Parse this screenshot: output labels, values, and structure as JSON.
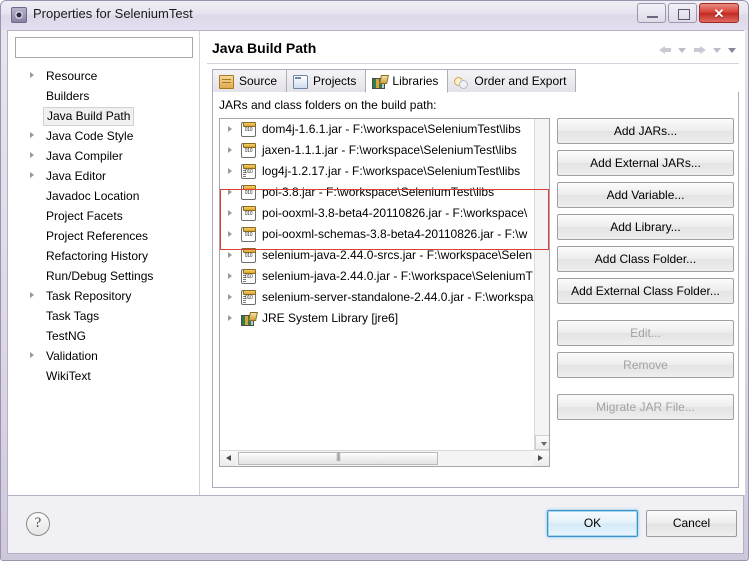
{
  "window": {
    "title": "Properties for SeleniumTest",
    "icon": "properties-icon",
    "minimize_label": "",
    "maximize_label": "",
    "close_label": "✕"
  },
  "sidebar": {
    "filter_value": "",
    "filter_placeholder": "",
    "items": [
      {
        "label": "Resource",
        "expandable": true,
        "selected": false
      },
      {
        "label": "Builders",
        "expandable": false,
        "selected": false
      },
      {
        "label": "Java Build Path",
        "expandable": false,
        "selected": true
      },
      {
        "label": "Java Code Style",
        "expandable": true,
        "selected": false
      },
      {
        "label": "Java Compiler",
        "expandable": true,
        "selected": false
      },
      {
        "label": "Java Editor",
        "expandable": true,
        "selected": false
      },
      {
        "label": "Javadoc Location",
        "expandable": false,
        "selected": false
      },
      {
        "label": "Project Facets",
        "expandable": false,
        "selected": false
      },
      {
        "label": "Project References",
        "expandable": false,
        "selected": false
      },
      {
        "label": "Refactoring History",
        "expandable": false,
        "selected": false
      },
      {
        "label": "Run/Debug Settings",
        "expandable": false,
        "selected": false
      },
      {
        "label": "Task Repository",
        "expandable": true,
        "selected": false
      },
      {
        "label": "Task Tags",
        "expandable": false,
        "selected": false
      },
      {
        "label": "TestNG",
        "expandable": false,
        "selected": false
      },
      {
        "label": "Validation",
        "expandable": true,
        "selected": false
      },
      {
        "label": "WikiText",
        "expandable": false,
        "selected": false
      }
    ]
  },
  "page": {
    "title": "Java Build Path",
    "nav": {
      "back_icon": "back-arrow-icon",
      "back_menu_icon": "chevron-down-icon",
      "forward_icon": "forward-arrow-icon",
      "forward_menu_icon": "chevron-down-icon",
      "view_menu_icon": "chevron-down-icon"
    }
  },
  "tabs": [
    {
      "label": "Source",
      "icon": "source-folder-icon",
      "active": false
    },
    {
      "label": "Projects",
      "icon": "projects-folder-icon",
      "active": false
    },
    {
      "label": "Libraries",
      "icon": "libraries-books-icon",
      "active": true
    },
    {
      "label": "Order and Export",
      "icon": "order-export-icon",
      "active": false
    }
  ],
  "libraries_tab": {
    "list_label": "JARs and class folders on the build path:",
    "entries": [
      {
        "label": "dom4j-1.6.1.jar - F:\\workspace\\SeleniumTest\\libs",
        "icon": "jar-icon",
        "highlighted": false
      },
      {
        "label": "jaxen-1.1.1.jar - F:\\workspace\\SeleniumTest\\libs",
        "icon": "jar-icon",
        "highlighted": false
      },
      {
        "label": "log4j-1.2.17.jar - F:\\workspace\\SeleniumTest\\libs",
        "icon": "jar-source-icon",
        "highlighted": false
      },
      {
        "label": "poi-3.8.jar - F:\\workspace\\SeleniumTest\\libs",
        "icon": "jar-icon",
        "highlighted": true
      },
      {
        "label": "poi-ooxml-3.8-beta4-20110826.jar - F:\\workspace\\",
        "icon": "jar-icon",
        "highlighted": true
      },
      {
        "label": "poi-ooxml-schemas-3.8-beta4-20110826.jar - F:\\w",
        "icon": "jar-icon",
        "highlighted": true
      },
      {
        "label": "selenium-java-2.44.0-srcs.jar - F:\\workspace\\Selen",
        "icon": "jar-icon",
        "highlighted": false
      },
      {
        "label": "selenium-java-2.44.0.jar - F:\\workspace\\SeleniumT",
        "icon": "jar-source-icon",
        "highlighted": false
      },
      {
        "label": "selenium-server-standalone-2.44.0.jar - F:\\workspa",
        "icon": "jar-source-icon",
        "highlighted": false
      },
      {
        "label": "JRE System Library [jre6]",
        "icon": "jre-library-icon",
        "highlighted": false
      }
    ],
    "buttons": [
      {
        "label": "Add JARs...",
        "disabled": false,
        "gap": false
      },
      {
        "label": "Add External JARs...",
        "disabled": false,
        "gap": false
      },
      {
        "label": "Add Variable...",
        "disabled": false,
        "gap": false
      },
      {
        "label": "Add Library...",
        "disabled": false,
        "gap": false
      },
      {
        "label": "Add Class Folder...",
        "disabled": false,
        "gap": false
      },
      {
        "label": "Add External Class Folder...",
        "disabled": false,
        "gap": false
      },
      {
        "label": "Edit...",
        "disabled": true,
        "gap": true
      },
      {
        "label": "Remove",
        "disabled": true,
        "gap": false
      },
      {
        "label": "Migrate JAR File...",
        "disabled": true,
        "gap": true
      }
    ],
    "scrollbar": {
      "horizontal_thumb_icon": "grip-icon",
      "left_arrow_icon": "arrow-left-icon",
      "right_arrow_icon": "arrow-right-icon",
      "down_arrow_icon": "arrow-down-icon"
    }
  },
  "footer": {
    "help_label": "?",
    "ok_label": "OK",
    "cancel_label": "Cancel"
  },
  "colors": {
    "accent": "#3a93c8",
    "annotation": "#e03c3c",
    "title_gradient_start": "#efeef4",
    "title_gradient_end": "#e4dff0",
    "close_red": "#d9443b"
  }
}
